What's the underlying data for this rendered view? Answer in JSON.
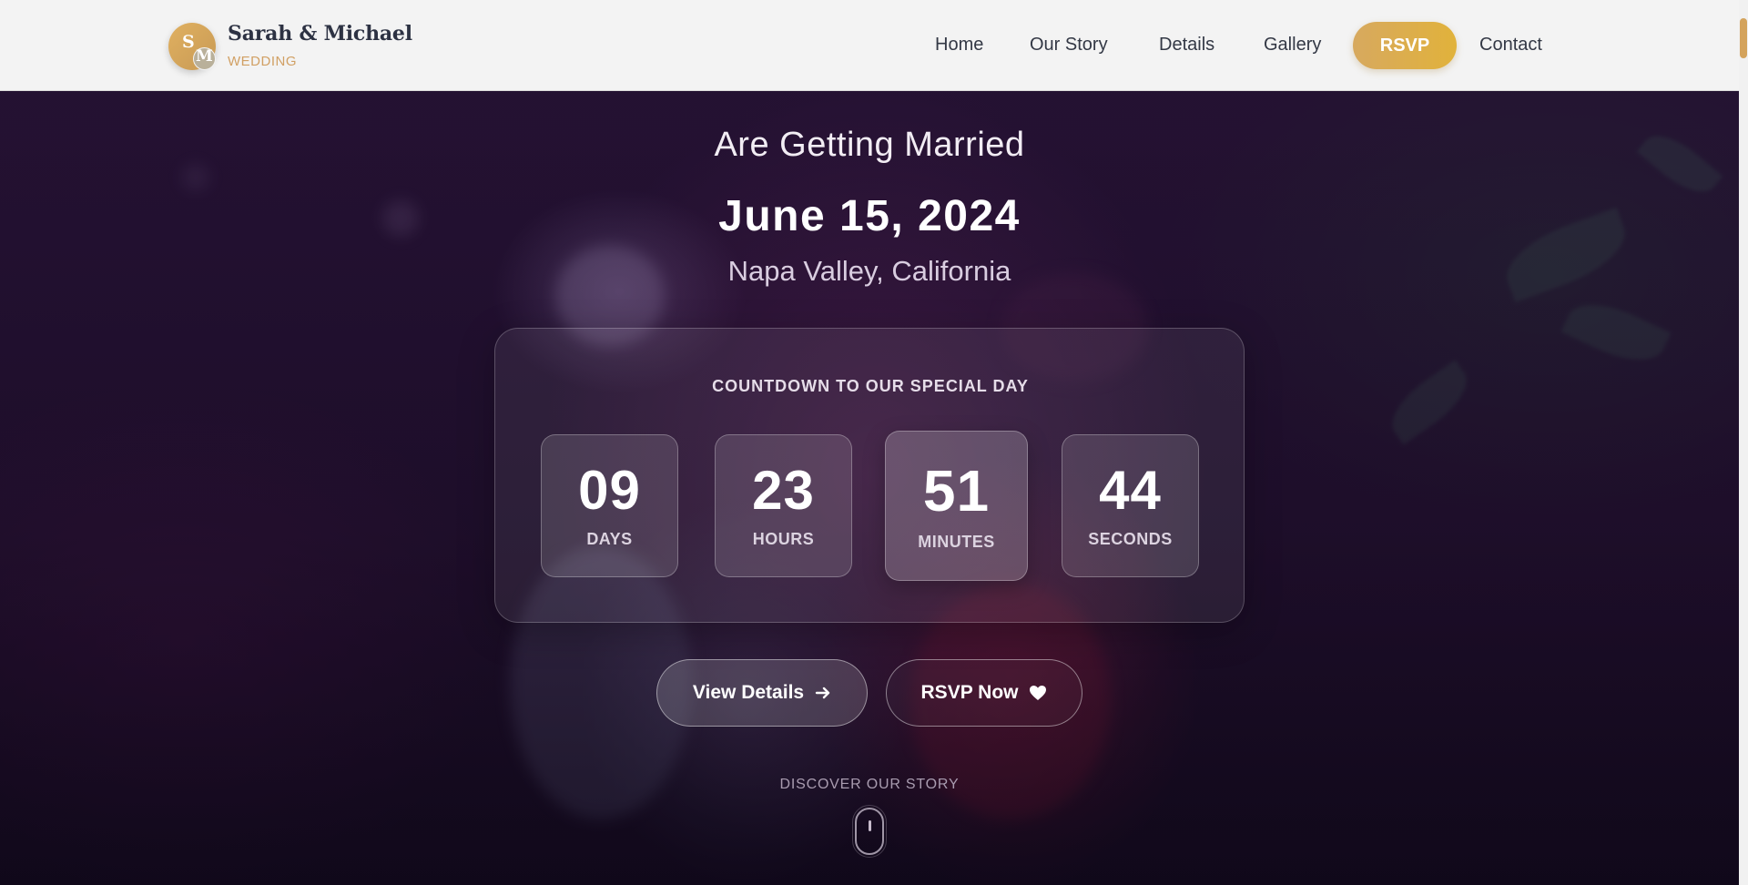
{
  "header": {
    "logo": {
      "initial_1": "S",
      "initial_2": "M"
    },
    "brand_name": "Sarah & Michael",
    "brand_tag": "WEDDING",
    "nav": {
      "home": "Home",
      "our_story": "Our Story",
      "details": "Details",
      "gallery": "Gallery",
      "rsvp": "RSVP",
      "contact": "Contact"
    }
  },
  "hero": {
    "subtitle": "Are Getting Married",
    "date": "June 15, 2024",
    "location": "Napa Valley, California"
  },
  "countdown": {
    "title": "COUNTDOWN TO OUR SPECIAL DAY",
    "units": [
      {
        "value": "09",
        "label": "DAYS"
      },
      {
        "value": "23",
        "label": "HOURS"
      },
      {
        "value": "51",
        "label": "MINUTES"
      },
      {
        "value": "44",
        "label": "SECONDS"
      }
    ]
  },
  "buttons": {
    "view_details": "View Details",
    "rsvp_now": "RSVP Now"
  },
  "discover": "DISCOVER OUR STORY",
  "colors": {
    "accent_gold": "#d7a95f",
    "header_bg": "#f3f3f3",
    "hero_bg": "#241233",
    "brand_text": "#2d3243"
  },
  "icons": {
    "arrow": "arrow-right-icon",
    "heart": "heart-icon",
    "scroll": "mouse-scroll-icon"
  }
}
